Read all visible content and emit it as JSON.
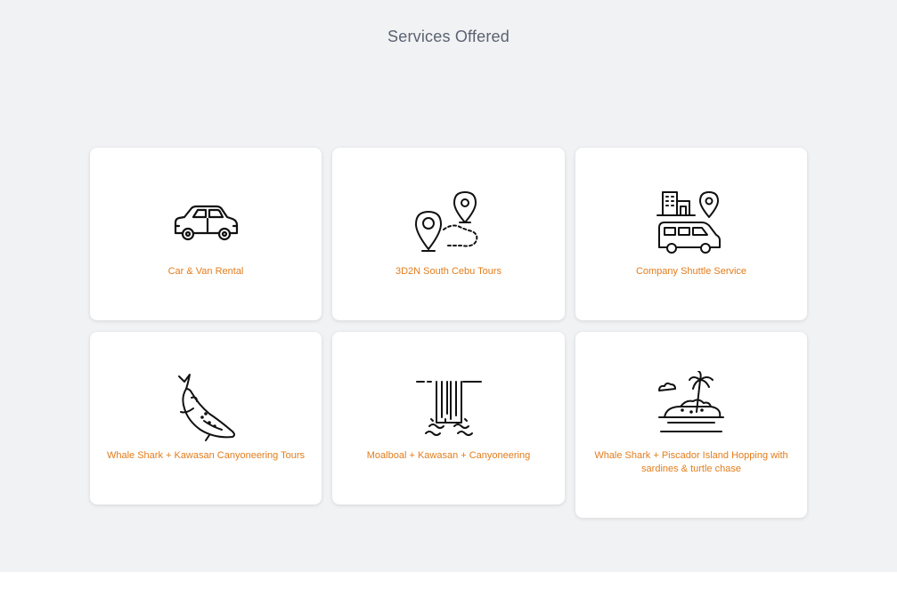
{
  "section": {
    "title": "Services Offered",
    "accent_color": "#e27d1c",
    "title_color": "#5a6270",
    "background": "#f1f2f4"
  },
  "services": [
    {
      "label": "Car & Van Rental",
      "icon": "car-icon"
    },
    {
      "label": "3D2N South Cebu Tours",
      "icon": "map-route-icon"
    },
    {
      "label": "Company Shuttle Service",
      "icon": "shuttle-van-icon"
    },
    {
      "label": "Whale Shark + Kawasan Canyoneering Tours",
      "icon": "whale-shark-icon"
    },
    {
      "label": "Moalboal + Kawasan + Canyoneering",
      "icon": "waterfall-icon"
    },
    {
      "label": "Whale Shark + Piscador Island Hopping with sardines & turtle chase",
      "icon": "island-icon"
    }
  ]
}
